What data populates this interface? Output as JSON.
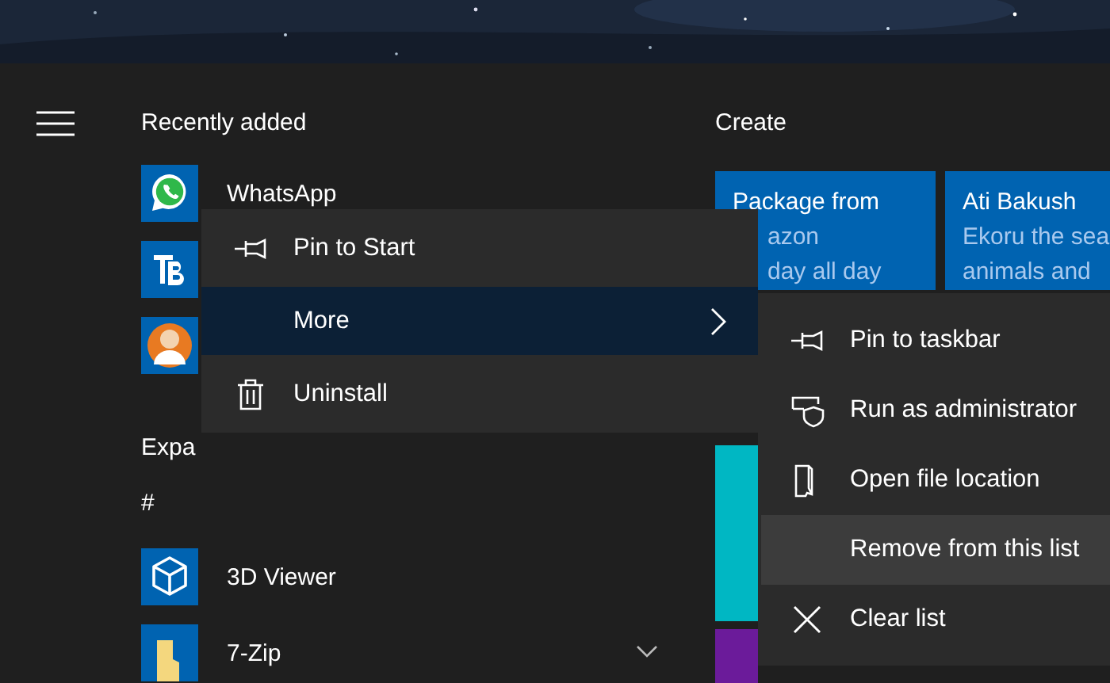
{
  "recently_added": {
    "title": "Recently added",
    "apps": [
      {
        "kind": "labeled",
        "name": "WhatsApp"
      },
      {
        "kind": "icon_only"
      },
      {
        "kind": "icon_only"
      }
    ]
  },
  "expand_label": "Expa",
  "section_letter": "#",
  "apps": [
    {
      "name": "3D Viewer",
      "expandable": false
    },
    {
      "name": "7-Zip",
      "expandable": true
    }
  ],
  "tiles": {
    "title": "Create",
    "items": [
      {
        "color": "#0063b1",
        "lines": [
          "Package from",
          "azon",
          "day all day"
        ]
      },
      {
        "color": "#0063b1",
        "lines": [
          "Ati Bakush",
          "Ekoru the sea",
          "animals and"
        ]
      },
      {
        "color": "#00b7c3"
      },
      {
        "color": "#6b1b9a"
      }
    ]
  },
  "context_menu": {
    "items": [
      {
        "label": "Pin to Start",
        "selected": false,
        "submenu": false
      },
      {
        "label": "More",
        "selected": true,
        "submenu": true
      },
      {
        "label": "Uninstall",
        "selected": false,
        "submenu": false
      }
    ]
  },
  "submenu": {
    "items": [
      {
        "label": "Pin to taskbar",
        "selected": false
      },
      {
        "label": "Run as administrator",
        "selected": false
      },
      {
        "label": "Open file location",
        "selected": false
      },
      {
        "label": "Remove from this list",
        "selected": true
      },
      {
        "label": "Clear list",
        "selected": false
      }
    ]
  }
}
